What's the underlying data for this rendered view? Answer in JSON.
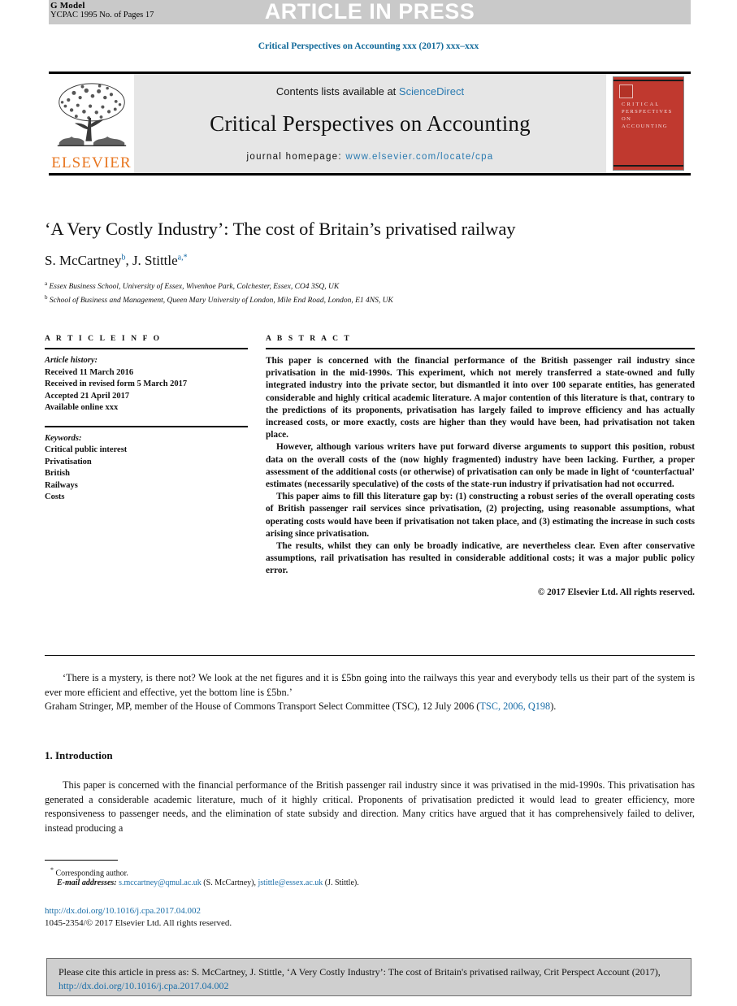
{
  "proof_header": {
    "g_model": "G Model",
    "pages": "YCPAC 1995 No. of Pages 17",
    "status_banner": "ARTICLE IN PRESS"
  },
  "running_head": "Critical Perspectives on Accounting xxx (2017) xxx–xxx",
  "masthead": {
    "contents_prefix": "Contents lists available at ",
    "contents_link": "ScienceDirect",
    "journal_title": "Critical Perspectives on Accounting",
    "homepage_prefix": "journal homepage: ",
    "homepage_url": "www.elsevier.com/locate/cpa",
    "publisher": "ELSEVIER",
    "cover_line1": "CRITICAL",
    "cover_line2": "PERSPECTIVES",
    "cover_line3": "ON ACCOUNTING"
  },
  "article": {
    "title": "‘A Very Costly Industry’: The cost of Britain’s privatised railway",
    "authors_1": "S. McCartney",
    "authors_sup_1": "b",
    "authors_sep": ", ",
    "authors_2": "J. Stittle",
    "authors_sup_2": "a,*",
    "affiliation_a_sup": "a",
    "affiliation_a": "Essex Business School, University of Essex, Wivenhoe Park, Colchester, Essex, CO4 3SQ, UK",
    "affiliation_b_sup": "b",
    "affiliation_b": "School of Business and Management, Queen Mary University of London, Mile End Road, London, E1 4NS, UK"
  },
  "article_info": {
    "heading": "A R T I C L E  I N F O",
    "history_label": "Article history:",
    "history": [
      "Received 11 March 2016",
      "Received in revised form 5 March 2017",
      "Accepted 21 April 2017",
      "Available online xxx"
    ],
    "keywords_label": "Keywords:",
    "keywords": [
      "Critical public interest",
      "Privatisation",
      "British",
      "Railways",
      "Costs"
    ]
  },
  "abstract": {
    "heading": "A B S T R A C T",
    "paragraphs": [
      "This paper is concerned with the financial performance of the British passenger rail industry since privatisation in the mid-1990s. This experiment, which not merely transferred a state-owned and fully integrated industry into the private sector, but dismantled it into over 100 separate entities, has generated considerable and highly critical academic literature. A major contention of this literature is that, contrary to the predictions of its proponents, privatisation has largely failed to improve efficiency and has actually increased costs, or more exactly, costs are higher than they would have been, had privatisation not taken place.",
      "However, although various writers have put forward diverse arguments to support this position, robust data on the overall costs of the (now highly fragmented) industry have been lacking. Further, a proper assessment of the additional costs (or otherwise) of privatisation can only be made in light of ‘counterfactual’ estimates (necessarily speculative) of the costs of the state-run industry if privatisation had not occurred.",
      "This paper aims to fill this literature gap by: (1) constructing a robust series of the overall operating costs of British passenger rail services since privatisation, (2) projecting, using reasonable assumptions, what operating costs would have been if privatisation not taken place, and (3) estimating the increase in such costs arising since privatisation.",
      "The results, whilst they can only be broadly indicative, are nevertheless clear. Even after conservative assumptions, rail privatisation has resulted in considerable additional costs; it was a major public policy error."
    ],
    "copyright": "© 2017 Elsevier Ltd. All rights reserved."
  },
  "epigraph": {
    "quote": "‘There is a mystery, is there not? We look at the net figures and it is £5bn going into the railways this year and everybody tells us their part of the system is ever more efficient and effective, yet the bottom line is £5bn.’",
    "attribution_pre": "Graham Stringer, MP, member of the House of Commons Transport Select Committee (TSC), 12 July 2006 (",
    "attribution_link": "TSC, 2006, Q198",
    "attribution_post": ")."
  },
  "introduction": {
    "heading": "1. Introduction",
    "paragraph": "This paper is concerned with the financial performance of the British passenger rail industry since it was privatised in the mid-1990s. This privatisation has generated a considerable academic literature, much of it highly critical. Proponents of privatisation predicted it would lead to greater efficiency, more responsiveness to passenger needs, and the elimination of state subsidy and direction. Many critics have argued that it has comprehensively failed to deliver, instead producing a"
  },
  "footnotes": {
    "corresponding_marker": "*",
    "corresponding_text": "Corresponding author.",
    "email_label": "E-mail addresses:",
    "email_1": "s.mccartney@qmul.ac.uk",
    "email_1_name": "(S. McCartney)",
    "email_2": "jstittle@essex.ac.uk",
    "email_2_name": "(J. Stittle).",
    "doi": "http://dx.doi.org/10.1016/j.cpa.2017.04.002",
    "issn": "1045-2354/© 2017 Elsevier Ltd. All rights reserved."
  },
  "cite_box": {
    "text_pre": "Please cite this article in press as: S. McCartney, J. Stittle, ‘A Very Costly Industry’: The cost of Britain's privatised railway, Crit Perspect Account (2017), ",
    "link": "http://dx.doi.org/10.1016/j.cpa.2017.04.002"
  },
  "colors": {
    "link_blue": "#1b6ea8",
    "sciencedirect_blue": "#2a7ab0",
    "elsevier_orange": "#e87722",
    "cover_red": "#c0392f",
    "banner_gray": "#c9c9c9"
  }
}
